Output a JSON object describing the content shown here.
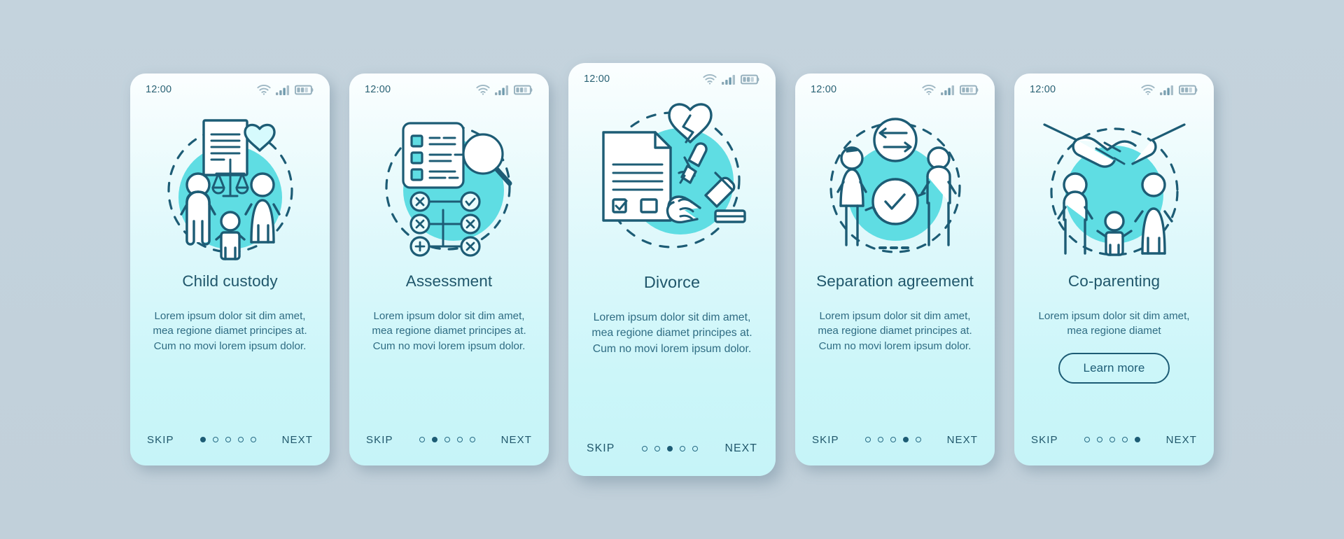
{
  "theme": {
    "page_background": "#c3d2dc",
    "card_gradient_top": "#fbfeff",
    "card_gradient_bottom": "#c6f4f8",
    "accent_circle": "#5fdde3",
    "ink": "#20576b",
    "ink_soft": "#2f6c83"
  },
  "status_bar": {
    "time": "12:00",
    "icons": [
      "wifi-icon",
      "cellular-signal-icon",
      "battery-icon"
    ]
  },
  "nav": {
    "skip_label": "SKIP",
    "next_label": "NEXT",
    "total_steps": 5
  },
  "screens": [
    {
      "id": "child-custody",
      "illustration": "family-with-document-scales-heart-illustration",
      "title": "Child custody",
      "description": "Lorem ipsum dolor sit dim amet, mea regione diamet principes at. Cum no movi lorem ipsum dolor.",
      "active_step": 1,
      "has_learn_more": false,
      "tall": false
    },
    {
      "id": "assessment",
      "illustration": "checklist-magnifier-flowchart-illustration",
      "title": "Assessment",
      "description": "Lorem ipsum dolor sit dim amet, mea regione diamet principes at. Cum no movi lorem ipsum dolor.",
      "active_step": 2,
      "has_learn_more": false,
      "tall": false
    },
    {
      "id": "divorce",
      "illustration": "broken-heart-document-gavel-illustration",
      "title": "Divorce",
      "description": "Lorem ipsum dolor sit dim amet, mea regione diamet principes at. Cum no movi lorem ipsum dolor.",
      "active_step": 3,
      "has_learn_more": false,
      "tall": true
    },
    {
      "id": "separation-agreement",
      "illustration": "two-people-separating-arrows-illustration",
      "title": "Separation agreement",
      "description": "Lorem ipsum dolor sit dim amet, mea regione diamet principes at. Cum no movi lorem ipsum dolor.",
      "active_step": 4,
      "has_learn_more": false,
      "tall": false
    },
    {
      "id": "co-parenting",
      "illustration": "handshake-parents-child-illustration",
      "title": "Co-parenting",
      "description": "Lorem ipsum dolor sit dim amet, mea regione diamet",
      "active_step": 5,
      "has_learn_more": true,
      "learn_more_label": "Learn more",
      "tall": false
    }
  ]
}
